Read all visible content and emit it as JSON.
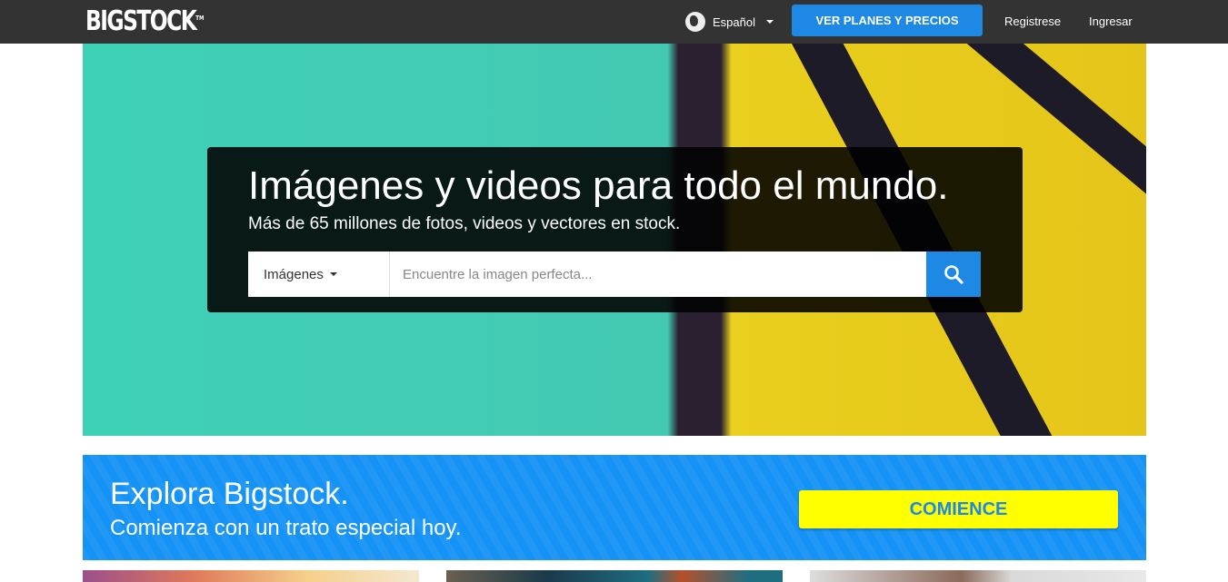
{
  "nav": {
    "logo": "BIGSTOCK",
    "tm": "TM",
    "language": "Español",
    "plans_button": "VER PLANES Y PRECIOS",
    "register": "Registrese",
    "login": "Ingresar"
  },
  "hero": {
    "title": "Imágenes y videos para todo el mundo.",
    "subtitle": "Más de 65 millones de fotos, videos y vectores en stock.",
    "search_type": "Imágenes",
    "search_placeholder": "Encuentre la imagen perfecta..."
  },
  "promo": {
    "title": "Explora Bigstock.",
    "subtitle": "Comienza con un trato especial hoy.",
    "button": "COMIENCE"
  },
  "colors": {
    "accent": "#1e88e5",
    "promo_bg": "#1592f5",
    "cta": "#ffff00",
    "nav_bg": "#333333"
  }
}
